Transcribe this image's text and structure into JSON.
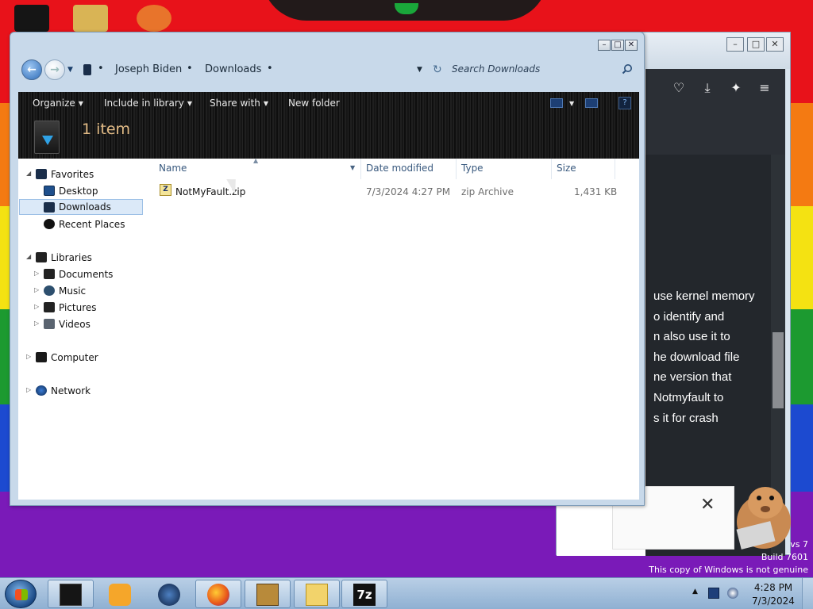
{
  "explorer": {
    "breadcrumb": [
      "Joseph Biden",
      "Downloads"
    ],
    "search_placeholder": "Search Downloads",
    "toolbar": {
      "organize": "Organize",
      "include_in_library": "Include in library",
      "share_with": "Share with",
      "new_folder": "New folder"
    },
    "item_count": "1 item",
    "nav": {
      "favorites": "Favorites",
      "desktop": "Desktop",
      "downloads": "Downloads",
      "recent_places": "Recent Places",
      "libraries": "Libraries",
      "documents": "Documents",
      "music": "Music",
      "pictures": "Pictures",
      "videos": "Videos",
      "computer": "Computer",
      "network": "Network"
    },
    "columns": {
      "name": "Name",
      "date_modified": "Date modified",
      "type": "Type",
      "size": "Size"
    },
    "files": [
      {
        "name": "NotMyFault.zip",
        "date_modified": "7/3/2024 4:27 PM",
        "type": "zip Archive",
        "size": "1,431 KB"
      }
    ]
  },
  "browser": {
    "page_text": [
      "use kernel memory",
      "o identify and",
      "n also use it to",
      "he download file",
      "ne version that",
      "Notmyfault to",
      "s it for crash"
    ],
    "close_glyph": "✕"
  },
  "watermark": {
    "line1": "vs 7",
    "line2": "Build 7601",
    "line3": "This copy of Windows is not genuine"
  },
  "taskbar": {
    "time": "4:28 PM",
    "date": "7/3/2024",
    "sevenzip_label": "7z"
  },
  "colors": {
    "accent": "#1c9aef",
    "toolbar_bg": "#151515",
    "item_count_color": "#e2bb86"
  }
}
